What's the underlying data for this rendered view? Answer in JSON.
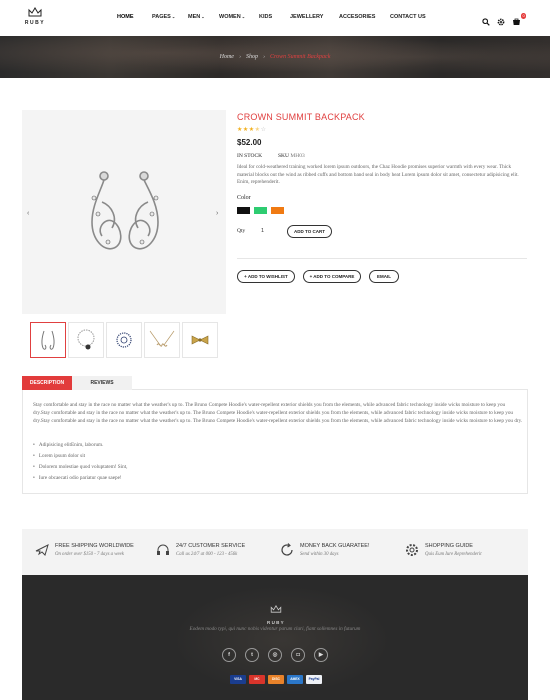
{
  "header": {
    "logo_text": "RUBY",
    "nav": [
      {
        "label": "HOME",
        "dropdown": false,
        "active": true
      },
      {
        "label": "PAGES",
        "dropdown": true
      },
      {
        "label": "MEN",
        "dropdown": true
      },
      {
        "label": "WOMEN",
        "dropdown": true
      },
      {
        "label": "KIDS",
        "dropdown": false
      },
      {
        "label": "JEWELLERY",
        "dropdown": false
      },
      {
        "label": "ACCESORIES",
        "dropdown": false
      },
      {
        "label": "CONTACT US",
        "dropdown": false
      }
    ],
    "icons": [
      "search-icon",
      "gear-icon",
      "cart-icon"
    ],
    "cart_count": "0",
    "accent": "#e43a3a"
  },
  "breadcrumb": {
    "items": [
      "Home",
      "Shop"
    ],
    "current": "Crown Summit Backpack"
  },
  "product": {
    "title": "CROWN SUMMIT BACKPACK",
    "rating": 3.5,
    "rating_max": 5,
    "price": "$52.00",
    "stock_label": "IN STOCK",
    "sku_label": "SKU",
    "sku_value": "MH03",
    "description": "Ideal for cold-weathered training worked lorem ipsum outdoors, the Chaz Hoodie promises superior warmth with every wear. Thick material blocks out the wind as ribbed cuffs and bottom band seal in body heat Lorem ipsum dolor sit amet, consectetur adipisicing elit. Enim, reprehenderit.",
    "color_label": "Color",
    "colors": [
      "#111111",
      "#2ecc71",
      "#f07a12"
    ],
    "qty_label": "Qty",
    "qty_value": "1",
    "add_to_cart": "ADD TO CART",
    "actions": [
      "+ ADD TO WISHLIST",
      "+ ADD TO COMPARE",
      "EMAIL"
    ],
    "thumbnails": [
      "earring-thumb",
      "bracelet-thumb",
      "ring-thumb",
      "necklace-thumb",
      "bow-pin-thumb"
    ]
  },
  "tabs": {
    "items": [
      "DESCRIPTION",
      "REVIEWS"
    ],
    "active": 0,
    "body": "Stay comfortable and stay in the race no matter what the weather's up to. The Bruno Compete Hoodie's water-repellent exterior shields you from the elements, while advanced fabric technology inside wicks moisture to keep you dry.Stay comfortable and stay in the race no matter what the weather's up to. The Bruno Compete Hoodie's water-repellent exterior shields you from the elements, while advanced fabric technology inside wicks moisture to keep you dry.Stay comfortable and stay in the race no matter what the weather's up to. The Bruno Compete Hoodie's water-repellent exterior shields you from the elements, while advanced fabric technology inside wicks moisture to keep you dry.",
    "bullets": [
      "Adipisicing elitEnim, laborum.",
      "Lorem ipsum dolor sit",
      "Dolorem molestiae quod voluptatem! Sint,",
      "Iure obcaecati odio pariatur quae saepe!"
    ]
  },
  "services": [
    {
      "icon": "plane-icon",
      "title": "FREE SHIPPING WORLDWIDE",
      "sub": "On order over $150 - 7 days a week"
    },
    {
      "icon": "headset-icon",
      "title": "24/7 CUSTOMER SERVICE",
      "sub": "Call us 24/7 at 000 - 123 - 456k"
    },
    {
      "icon": "refresh-icon",
      "title": "MONEY BACK GUARATEE!",
      "sub": "Send within 30 days"
    },
    {
      "icon": "cog-icon",
      "title": "SHOPPING GUIDE",
      "sub": "Quis Eum Iure Reprehenderit"
    }
  ],
  "footer": {
    "logo_text": "RUBY",
    "tagline": "Eodem modo typi, qui nunc nobis videntur parum clari, fiant sollemnes in futurum",
    "social": [
      {
        "icon": "facebook-icon",
        "glyph": "f"
      },
      {
        "icon": "twitter-icon",
        "glyph": "t"
      },
      {
        "icon": "dribbble-icon",
        "glyph": "◎"
      },
      {
        "icon": "instagram-icon",
        "glyph": "◘"
      },
      {
        "icon": "youtube-icon",
        "glyph": "▶"
      }
    ],
    "payments": [
      {
        "name": "VISA",
        "color": "#1a3d8f"
      },
      {
        "name": "MC",
        "color": "#d9342b"
      },
      {
        "name": "DISC",
        "color": "#e8822a"
      },
      {
        "name": "AMEX",
        "color": "#2b77c9"
      },
      {
        "name": "PayPal",
        "color": "#eef1f6"
      }
    ]
  }
}
